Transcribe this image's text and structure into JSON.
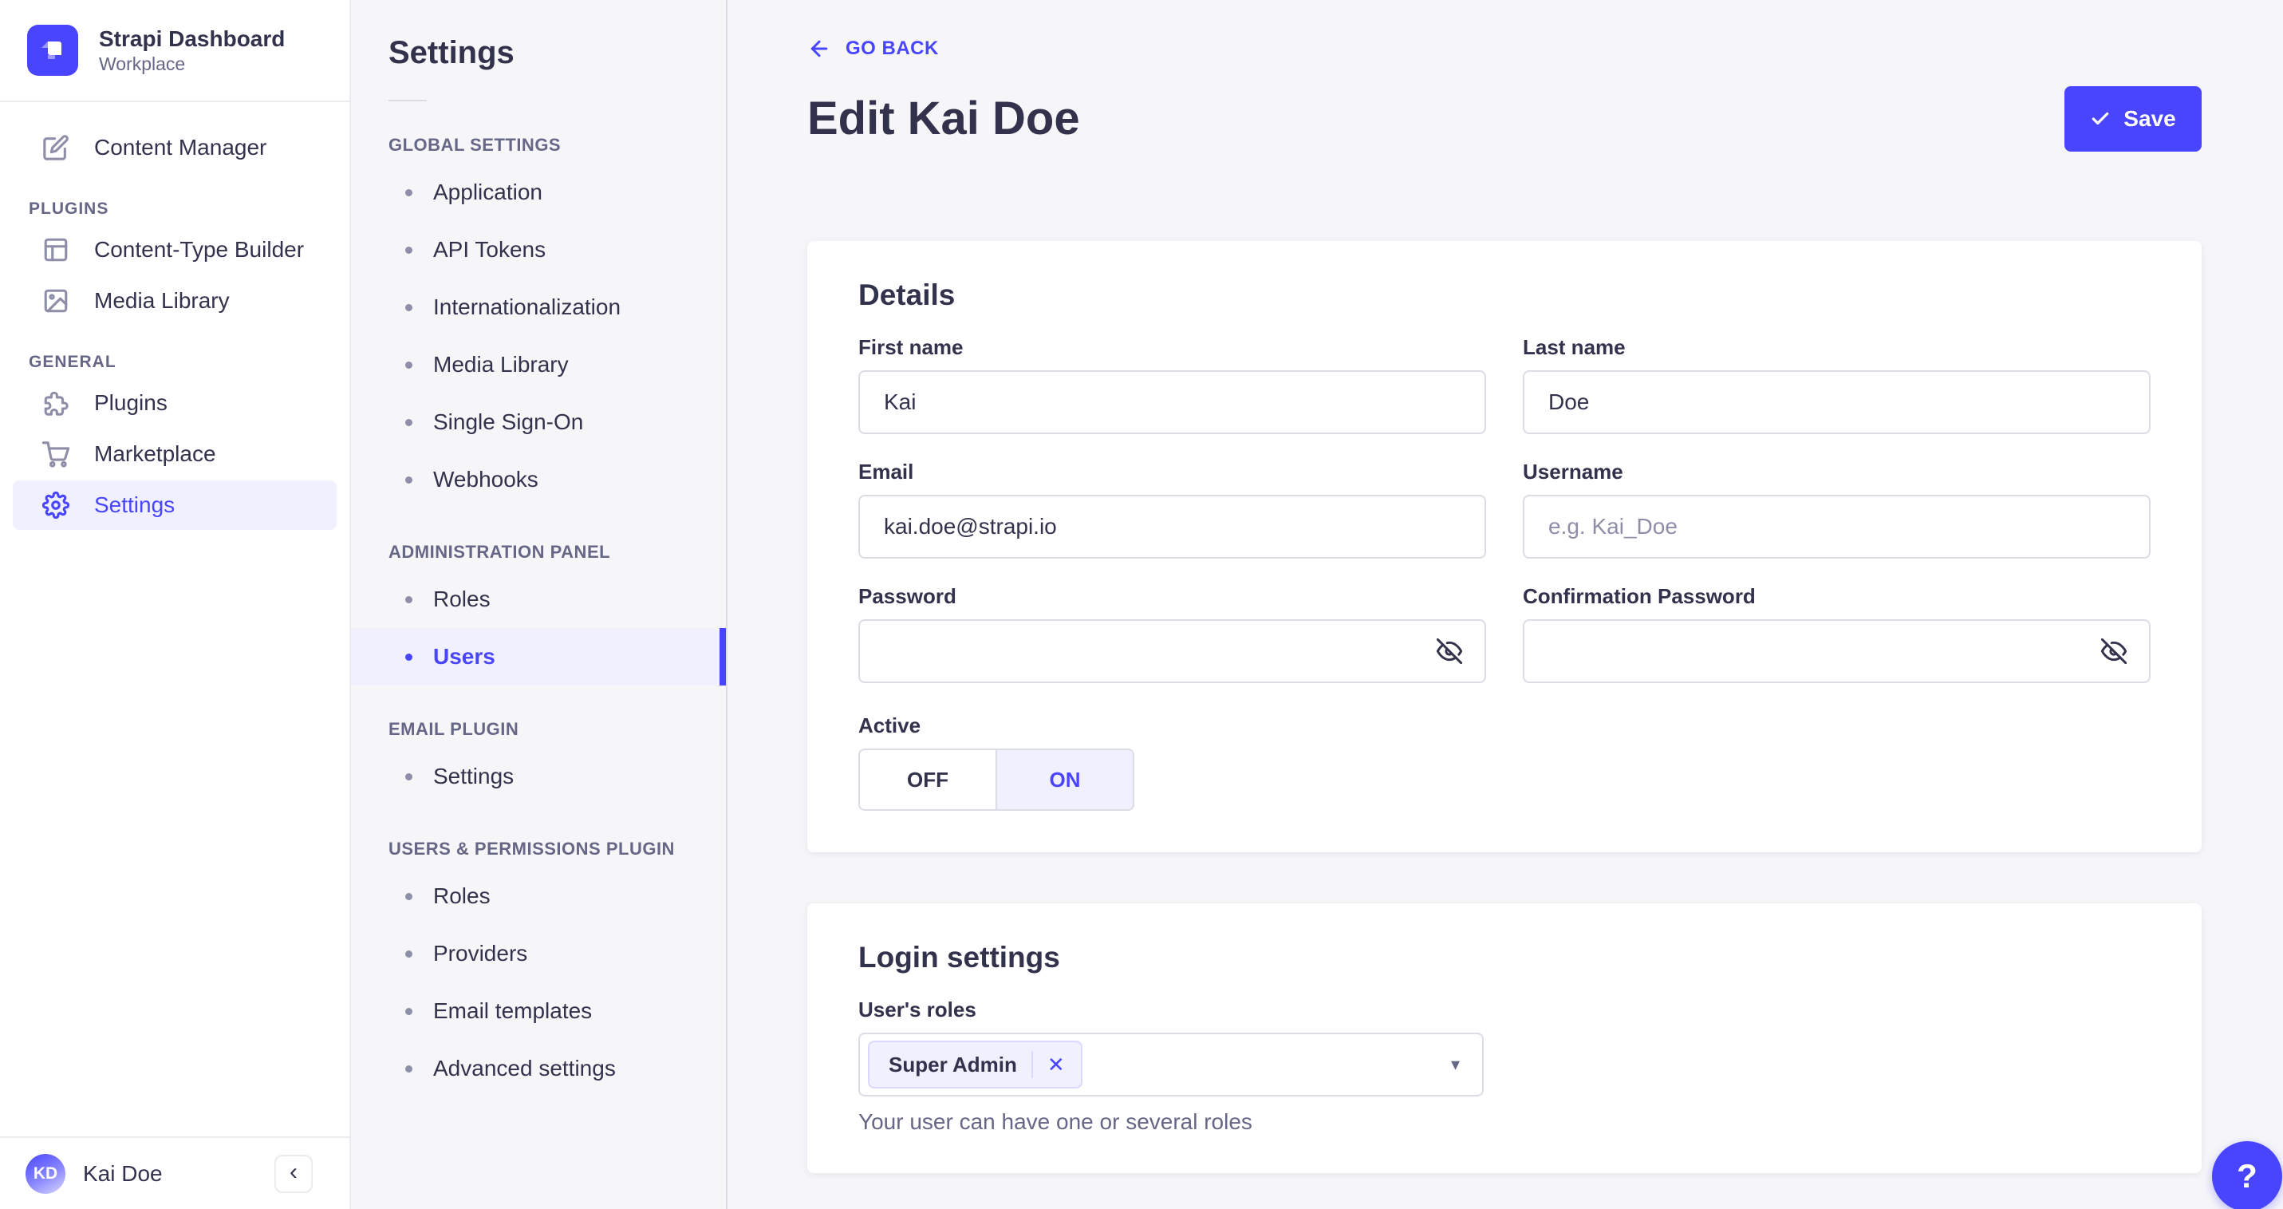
{
  "colors": {
    "accent": "#4945ff",
    "accent_bg": "#f0f0ff",
    "text": "#32324d",
    "muted": "#666687",
    "placeholder": "#8e8ea9",
    "border": "#dcdce4",
    "panel_border": "#eaeaef",
    "background": "#f6f6f9",
    "card": "#ffffff"
  },
  "app": {
    "title": "Strapi Dashboard",
    "subtitle": "Workplace"
  },
  "sidebar": {
    "main_items": [
      {
        "label": "Content Manager",
        "icon": "content-manager-icon"
      }
    ],
    "sections": [
      {
        "title": "PLUGINS",
        "items": [
          {
            "label": "Content-Type Builder",
            "icon": "layout-grid-icon"
          },
          {
            "label": "Media Library",
            "icon": "image-icon"
          }
        ]
      },
      {
        "title": "GENERAL",
        "items": [
          {
            "label": "Plugins",
            "icon": "puzzle-icon"
          },
          {
            "label": "Marketplace",
            "icon": "cart-icon"
          },
          {
            "label": "Settings",
            "icon": "gear-icon"
          }
        ]
      }
    ],
    "user": {
      "initials": "KD",
      "name": "Kai Doe"
    },
    "collapse_icon": "‹"
  },
  "settings_nav": {
    "title": "Settings",
    "sections": [
      {
        "title": "GLOBAL SETTINGS",
        "items": [
          {
            "label": "Application"
          },
          {
            "label": "API Tokens"
          },
          {
            "label": "Internationalization"
          },
          {
            "label": "Media Library"
          },
          {
            "label": "Single Sign-On"
          },
          {
            "label": "Webhooks"
          }
        ]
      },
      {
        "title": "ADMINISTRATION PANEL",
        "items": [
          {
            "label": "Roles"
          },
          {
            "label": "Users"
          }
        ]
      },
      {
        "title": "EMAIL PLUGIN",
        "items": [
          {
            "label": "Settings"
          }
        ]
      },
      {
        "title": "USERS & PERMISSIONS PLUGIN",
        "items": [
          {
            "label": "Roles"
          },
          {
            "label": "Providers"
          },
          {
            "label": "Email templates"
          },
          {
            "label": "Advanced settings"
          }
        ]
      }
    ]
  },
  "header": {
    "back": "GO BACK",
    "title": "Edit Kai Doe",
    "save": "Save"
  },
  "details": {
    "title": "Details",
    "first_name": {
      "label": "First name",
      "value": "Kai"
    },
    "last_name": {
      "label": "Last name",
      "value": "Doe"
    },
    "email": {
      "label": "Email",
      "value": "kai.doe@strapi.io"
    },
    "username": {
      "label": "Username",
      "placeholder": "e.g. Kai_Doe"
    },
    "password": {
      "label": "Password"
    },
    "confirm_password": {
      "label": "Confirmation Password"
    },
    "active": {
      "label": "Active",
      "off": "OFF",
      "on": "ON",
      "state": "on"
    }
  },
  "login": {
    "title": "Login settings",
    "roles_label": "User's roles",
    "role_tag": "Super Admin",
    "remove_icon": "✕",
    "caret_icon": "▾",
    "hint": "Your user can have one or several roles"
  },
  "help": {
    "icon": "?"
  }
}
